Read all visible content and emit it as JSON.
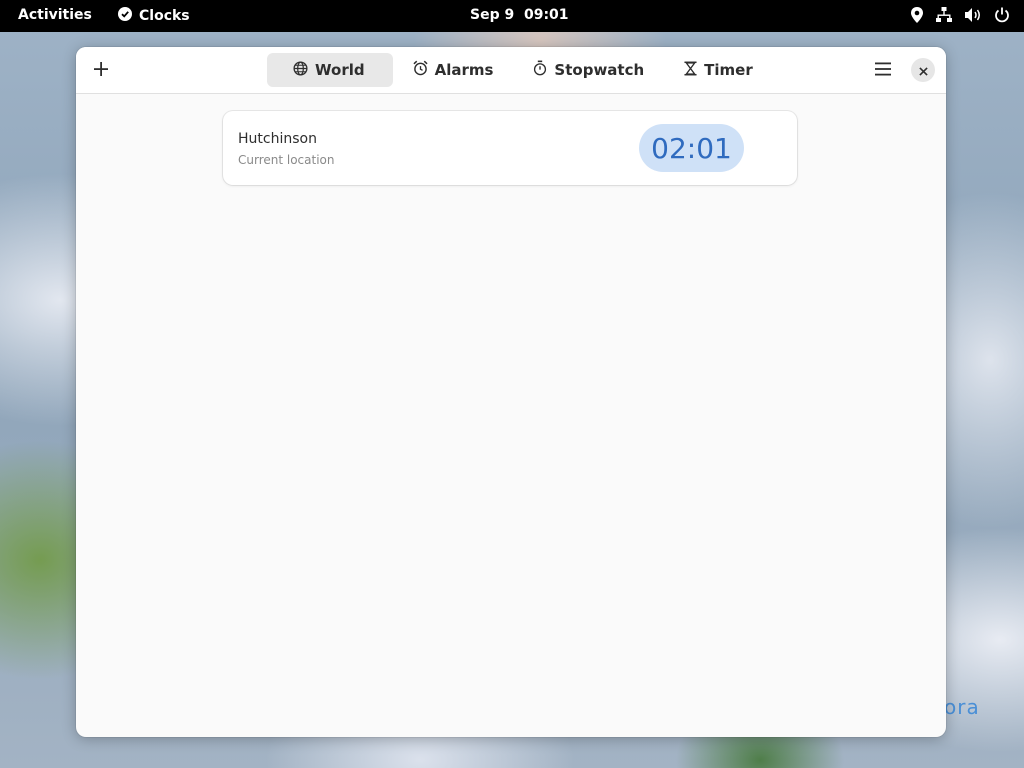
{
  "topbar": {
    "activities": "Activities",
    "app_name": "Clocks",
    "datetime": "Sep 9  09:01",
    "tray_icons": [
      "location-icon",
      "network-icon",
      "volume-icon",
      "power-icon"
    ]
  },
  "window": {
    "tabs": [
      {
        "label": "World",
        "icon": "globe-icon",
        "active": true
      },
      {
        "label": "Alarms",
        "icon": "alarm-icon",
        "active": false
      },
      {
        "label": "Stopwatch",
        "icon": "stopwatch-icon",
        "active": false
      },
      {
        "label": "Timer",
        "icon": "hourglass-icon",
        "active": false
      }
    ],
    "world_clocks": [
      {
        "city": "Hutchinson",
        "subtitle": "Current location",
        "time": "02:01"
      }
    ]
  },
  "desktop": {
    "logo_text": "ora"
  },
  "colors": {
    "accent": "#2f6bbf",
    "time_pill_bg": "#cfe1f7",
    "topbar_bg": "#000000"
  }
}
